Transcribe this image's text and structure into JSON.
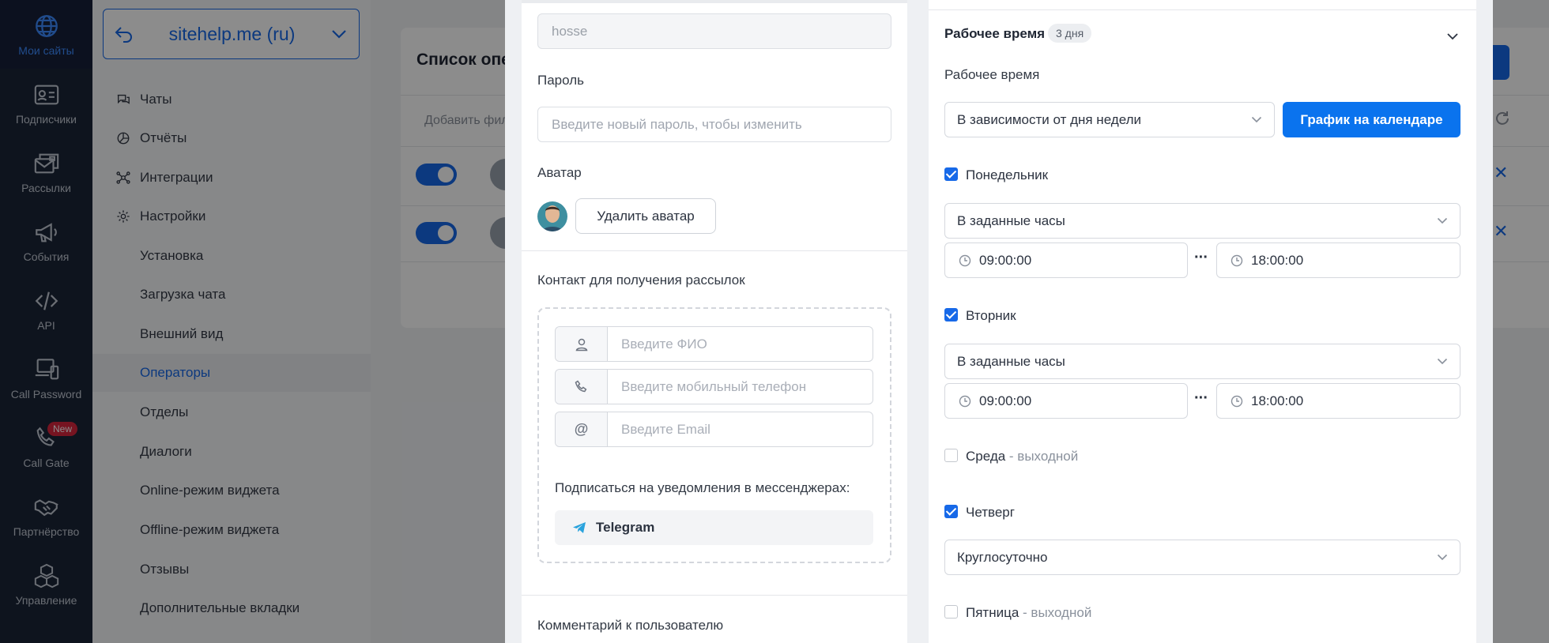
{
  "nav": {
    "items": [
      {
        "label": "Мои сайты",
        "icon": "globe-icon",
        "active": true
      },
      {
        "label": "Подписчики",
        "icon": "id-card-icon"
      },
      {
        "label": "Рассылки",
        "icon": "mail-stack-icon"
      },
      {
        "label": "События",
        "icon": "megaphone-icon"
      },
      {
        "label": "API",
        "icon": "code-icon"
      },
      {
        "label": "Call Password",
        "icon": "devices-icon"
      },
      {
        "label": "Call Gate",
        "icon": "phone-icon",
        "badge": "New"
      },
      {
        "label": "Партнёрство",
        "icon": "handshake-icon"
      },
      {
        "label": "Управление",
        "icon": "boxes-icon"
      }
    ]
  },
  "sidebar": {
    "site": "sitehelp.me (ru)",
    "menu": [
      {
        "label": "Чаты"
      },
      {
        "label": "Отчёты"
      },
      {
        "label": "Интеграции"
      },
      {
        "label": "Настройки"
      },
      {
        "label": "Установка"
      },
      {
        "label": "Загрузка чата"
      },
      {
        "label": "Внешний вид"
      },
      {
        "label": "Операторы",
        "active": true
      },
      {
        "label": "Отделы"
      },
      {
        "label": "Диалоги"
      },
      {
        "label": "Online-режим виджета"
      },
      {
        "label": "Offline-режим виджета"
      },
      {
        "label": "Отзывы"
      },
      {
        "label": "Дополнительные вкладки"
      }
    ]
  },
  "background": {
    "title": "Список опе",
    "filter": "Добавить фил"
  },
  "form": {
    "login_value": "hosse",
    "password_label": "Пароль",
    "password_placeholder": "Введите новый пароль, чтобы изменить",
    "avatar_label": "Аватар",
    "remove_avatar": "Удалить аватар",
    "contact_label": "Контакт для получения рассылок",
    "name_placeholder": "Введите ФИО",
    "phone_placeholder": "Введите мобильный телефон",
    "email_placeholder": "Введите Email",
    "subscribe_label": "Подписаться на уведомления в мессенджерах:",
    "telegram": "Telegram",
    "comment_label": "Комментарий к пользователю"
  },
  "schedule": {
    "header": "Рабочее время",
    "days_badge": "3 дня",
    "label": "Рабочее время",
    "mode": "В зависимости от дня недели",
    "calendar_button": "График на календаре",
    "days": [
      {
        "name": "Понедельник",
        "checked": true,
        "mode": "В заданные часы",
        "from": "09:00:00",
        "to": "18:00:00"
      },
      {
        "name": "Вторник",
        "checked": true,
        "mode": "В заданные часы",
        "from": "09:00:00",
        "to": "18:00:00"
      },
      {
        "name": "Среда",
        "checked": false,
        "note": "- выходной"
      },
      {
        "name": "Четверг",
        "checked": true,
        "mode": "Круглосуточно"
      },
      {
        "name": "Пятница",
        "checked": false,
        "note": "- выходной"
      }
    ],
    "range_separator": "···"
  },
  "colors": {
    "accent": "#1769e8",
    "nav_bg": "#1b2537",
    "primary_button": "#0a73ee",
    "badge": "#d7263d"
  }
}
